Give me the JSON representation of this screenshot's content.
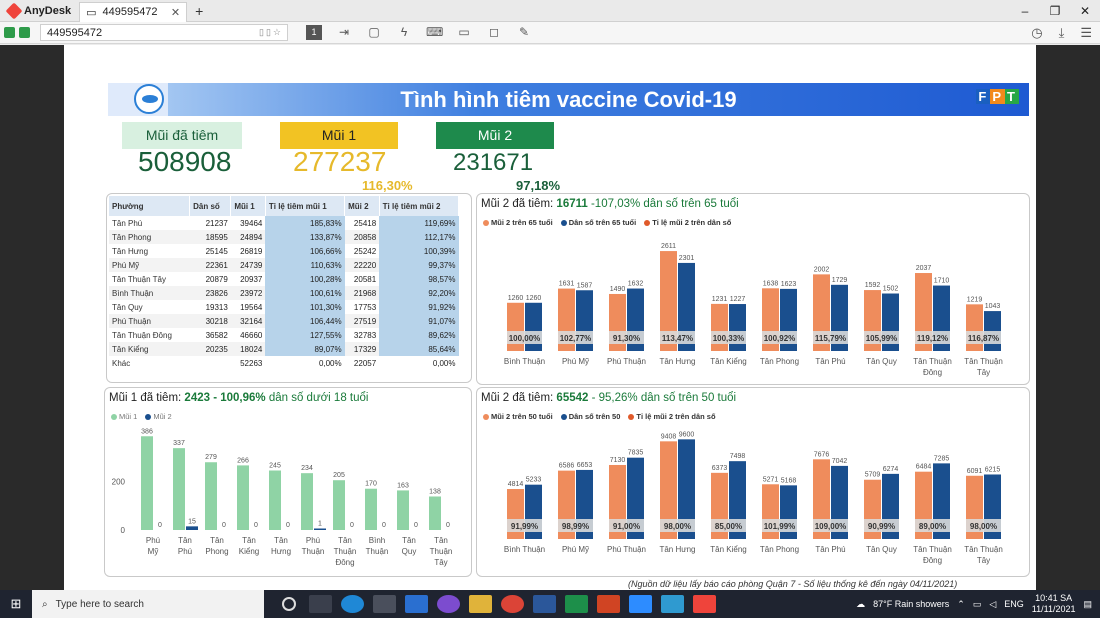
{
  "window": {
    "app": "AnyDesk",
    "tab": "449595472",
    "address": "449595472"
  },
  "dashboard": {
    "title": "Tình hình tiêm vaccine Covid-19",
    "brand": "FPT",
    "kpis": [
      {
        "label": "Mũi đã tiêm",
        "value": "508908",
        "pct": "",
        "bg": "#d8f0e0",
        "color": "#1a5f3a",
        "val_color": "#1a5f3a"
      },
      {
        "label": "Mũi 1",
        "value": "277237",
        "pct": "116,30%",
        "bg": "#f2c323",
        "color": "#222",
        "val_color": "#e6b92b"
      },
      {
        "label": "Mũi 2",
        "value": "231671",
        "pct": "97,18%",
        "bg": "#1e8a4c",
        "color": "#fff",
        "val_color": "#1a5f3a"
      }
    ],
    "table": {
      "headers": [
        "Phường",
        "Dân số",
        "Mũi 1",
        "Tỉ lệ tiêm mũi 1",
        "Mũi 2",
        "Tỉ lệ tiêm mũi 2"
      ],
      "rows": [
        [
          "Tân Phú",
          "21237",
          "39464",
          "185,83%",
          "25418",
          "119,69%"
        ],
        [
          "Tân Phong",
          "18595",
          "24894",
          "133,87%",
          "20858",
          "112,17%"
        ],
        [
          "Tân Hưng",
          "25145",
          "26819",
          "106,66%",
          "25242",
          "100,39%"
        ],
        [
          "Phú Mỹ",
          "22361",
          "24739",
          "110,63%",
          "22220",
          "99,37%"
        ],
        [
          "Tân Thuận Tây",
          "20879",
          "20937",
          "100,28%",
          "20581",
          "98,57%"
        ],
        [
          "Bình Thuận",
          "23826",
          "23972",
          "100,61%",
          "21968",
          "92,20%"
        ],
        [
          "Tân Quy",
          "19313",
          "19564",
          "101,30%",
          "17753",
          "91,92%"
        ],
        [
          "Phú Thuận",
          "30218",
          "32164",
          "106,44%",
          "27519",
          "91,07%"
        ],
        [
          "Tân Thuận Đông",
          "36582",
          "46660",
          "127,55%",
          "32783",
          "89,62%"
        ],
        [
          "Tân Kiểng",
          "20235",
          "18024",
          "89,07%",
          "17329",
          "85,64%"
        ],
        [
          "Khác",
          "",
          "52263",
          "0,00%",
          "22057",
          "0,00%"
        ]
      ]
    },
    "panel_65": {
      "title_prefix": "Mũi 2 đã tiêm: ",
      "title_value": "16711",
      "title_suffix": " -107,03% dân số trên 65 tuổi",
      "legend": [
        "Mũi 2 trên 65 tuổi",
        "Dân số trên 65 tuổi",
        "Tỉ lệ mũi 2 trên dân số"
      ]
    },
    "panel_50": {
      "title_prefix": "Mũi 2 đã tiêm: ",
      "title_value": "65542",
      "title_suffix": " -  95,26% dân số trên 50 tuổi",
      "legend": [
        "Mũi 2 trên 50 tuổi",
        "Dân số trên 50",
        "Tỉ lệ mũi 2 trên dân số"
      ]
    },
    "panel_18": {
      "title_prefix": "Mũi 1 đã tiêm: ",
      "title_value": "2423 - 100,96%",
      "title_suffix": " dân số dưới 18 tuổi",
      "legend": [
        "Mũi 1",
        "Mũi 2"
      ]
    },
    "footnote": "(Nguồn dữ liệu lấy báo cáo phòng Quận 7 - Số liệu thống kê đến ngày 04/11/2021)",
    "colors": {
      "orange": "#ef8c5c",
      "navy": "#1a4f8e",
      "green": "#8fd3a5",
      "pct_bg": "#d9d9d9"
    }
  },
  "chart_data": [
    {
      "type": "bar",
      "id": "over65",
      "categories": [
        "Bình Thuận",
        "Phú Mỹ",
        "Phú Thuận",
        "Tân Hưng",
        "Tân Kiểng",
        "Tân Phong",
        "Tân Phú",
        "Tân Quy",
        "Tân Thuận Đông",
        "Tân Thuận Tây"
      ],
      "series": [
        {
          "name": "Mũi 2 trên 65 tuổi",
          "values": [
            1260,
            1631,
            1490,
            2611,
            1231,
            1638,
            2002,
            1592,
            2037,
            1219
          ]
        },
        {
          "name": "Dân số trên 65 tuổi",
          "values": [
            1260,
            1587,
            1632,
            2301,
            1227,
            1623,
            1729,
            1502,
            1710,
            1043
          ]
        },
        {
          "name": "Tỉ lệ mũi 2 trên dân số",
          "values": [
            "100,00%",
            "102,77%",
            "91,30%",
            "113,47%",
            "100,33%",
            "100,92%",
            "115,79%",
            "105,99%",
            "119,12%",
            "116,87%"
          ]
        }
      ]
    },
    {
      "type": "bar",
      "id": "over50",
      "categories": [
        "Bình Thuận",
        "Phú Mỹ",
        "Phú Thuận",
        "Tân Hưng",
        "Tân Kiểng",
        "Tân Phong",
        "Tân Phú",
        "Tân Quy",
        "Tân Thuận Đông",
        "Tân Thuận Tây"
      ],
      "series": [
        {
          "name": "Mũi 2 trên 50 tuổi",
          "values": [
            4814,
            6586,
            7130,
            9408,
            6373,
            5271,
            7676,
            5709,
            6484,
            6091
          ]
        },
        {
          "name": "Dân số trên 50",
          "values": [
            5233,
            6653,
            7835,
            9600,
            7498,
            5168,
            7042,
            6274,
            7285,
            6215
          ]
        },
        {
          "name": "Tỉ lệ mũi 2 trên dân số",
          "values": [
            "91,99%",
            "98,99%",
            "91,00%",
            "98,00%",
            "85,00%",
            "101,99%",
            "109,00%",
            "90,99%",
            "89,00%",
            "98,00%"
          ]
        }
      ]
    },
    {
      "type": "bar",
      "id": "under18",
      "categories": [
        "Phú Mỹ",
        "Tân Phú",
        "Tân Phong",
        "Tân Kiểng",
        "Tân Hưng",
        "Phú Thuận",
        "Tân Thuận Đông",
        "Bình Thuận",
        "Tân Quy",
        "Tân Thuận Tây"
      ],
      "yticks": [
        0,
        200
      ],
      "series": [
        {
          "name": "Mũi 1",
          "values": [
            386,
            337,
            279,
            266,
            245,
            234,
            205,
            170,
            163,
            138
          ]
        },
        {
          "name": "Mũi 2",
          "values": [
            0,
            15,
            0,
            0,
            0,
            1,
            0,
            0,
            0,
            0
          ]
        }
      ]
    }
  ],
  "taskbar": {
    "search": "Type here to search",
    "weather": "87°F  Rain showers",
    "lang": "ENG",
    "time": "10:41 SA",
    "date": "11/11/2021"
  }
}
